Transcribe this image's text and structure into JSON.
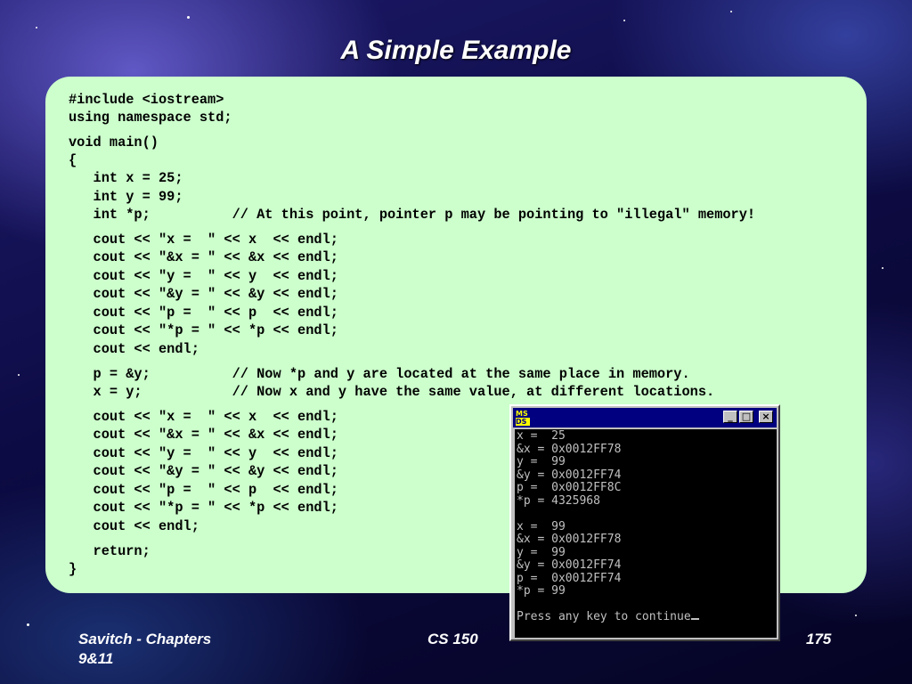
{
  "slide": {
    "title": "A Simple Example"
  },
  "code": {
    "lines": [
      "#include <iostream>",
      "using namespace std;",
      "void main()",
      "{",
      "   int x = 25;",
      "   int y = 99;",
      "   int *p;          // At this point, pointer p may be pointing to \"illegal\" memory!",
      "   cout << \"x =  \" << x  << endl;",
      "   cout << \"&x = \" << &x << endl;",
      "   cout << \"y =  \" << y  << endl;",
      "   cout << \"&y = \" << &y << endl;",
      "   cout << \"p =  \" << p  << endl;",
      "   cout << \"*p = \" << *p << endl;",
      "   cout << endl;",
      "   p = &y;          // Now *p and y are located at the same place in memory.",
      "   x = y;           // Now x and y have the same value, at different locations.",
      "   cout << \"x =  \" << x  << endl;",
      "   cout << \"&x = \" << &x << endl;",
      "   cout << \"y =  \" << y  << endl;",
      "   cout << \"&y = \" << &y << endl;",
      "   cout << \"p =  \" << p  << endl;",
      "   cout << \"*p = \" << *p << endl;",
      "   cout << endl;",
      "   return;",
      "}"
    ]
  },
  "console": {
    "icon_label_top": "MS",
    "icon_label_bottom": "DS",
    "minimize_glyph": "_",
    "maximize_glyph": "□",
    "close_glyph": "×",
    "lines": [
      "x =  25",
      "&x = 0x0012FF78",
      "y =  99",
      "&y = 0x0012FF74",
      "p =  0x0012FF8C",
      "*p = 4325968",
      "",
      "x =  99",
      "&x = 0x0012FF78",
      "y =  99",
      "&y = 0x0012FF74",
      "p =  0x0012FF74",
      "*p = 99",
      "",
      "Press any key to continue"
    ]
  },
  "footer": {
    "left_line1": "Savitch - Chapters",
    "left_line2": "9&11",
    "center": "CS 150",
    "page_number": "175"
  }
}
